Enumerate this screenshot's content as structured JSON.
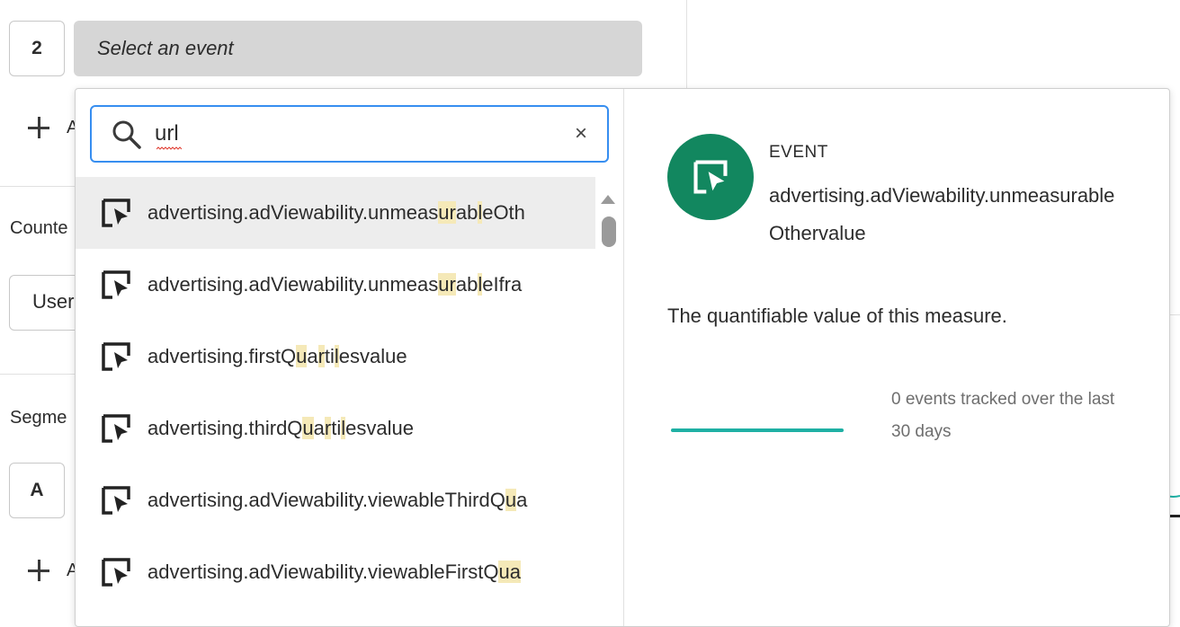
{
  "step": {
    "number": "2"
  },
  "event_select": {
    "placeholder": "Select an event"
  },
  "background": {
    "add_peek_1": "A",
    "counter_label": "Counte",
    "user_select": "User",
    "segment_label": "Segme",
    "segment_box": "A",
    "add_peek_2": "A"
  },
  "search": {
    "value": "url",
    "clear_icon": "close-icon"
  },
  "results": [
    {
      "segments": [
        [
          "advertising.adViewability.unmeas",
          false
        ],
        [
          "ur",
          true
        ],
        [
          "ab",
          false
        ],
        [
          "l",
          true
        ],
        [
          "eOth",
          false
        ]
      ],
      "selected": true
    },
    {
      "segments": [
        [
          "advertising.adViewability.unmeas",
          false
        ],
        [
          "ur",
          true
        ],
        [
          "ab",
          false
        ],
        [
          "l",
          true
        ],
        [
          "eIfra",
          false
        ]
      ],
      "selected": false
    },
    {
      "segments": [
        [
          "advertising.firstQ",
          false
        ],
        [
          "u",
          true
        ],
        [
          "a",
          false
        ],
        [
          "r",
          true
        ],
        [
          "ti",
          false
        ],
        [
          "l",
          true
        ],
        [
          "esvalue",
          false
        ]
      ],
      "selected": false
    },
    {
      "segments": [
        [
          "advertising.thirdQ",
          false
        ],
        [
          "u",
          true
        ],
        [
          "a",
          false
        ],
        [
          "r",
          true
        ],
        [
          "ti",
          false
        ],
        [
          "l",
          true
        ],
        [
          "esvalue",
          false
        ]
      ],
      "selected": false
    },
    {
      "segments": [
        [
          "advertising.adViewability.viewableThirdQ",
          false
        ],
        [
          "u",
          true
        ],
        [
          "a",
          false
        ]
      ],
      "selected": false
    },
    {
      "segments": [
        [
          "advertising.adViewability.viewableFirstQ",
          false
        ],
        [
          "ua",
          true
        ],
        [
          "",
          false
        ]
      ],
      "selected": false
    }
  ],
  "detail": {
    "type": "EVENT",
    "name": "advertising.adViewability.unmeasurableOthervalue",
    "description": "The quantifiable value of this measure.",
    "tracked": "0 events tracked over the last 30 days"
  },
  "colors": {
    "accent": "#378ef0",
    "event_green": "#12875f",
    "spark": "#1fb0a4",
    "highlight": "#f5e9b8"
  },
  "icons": {
    "event": "event-cursor-icon",
    "search": "search-icon",
    "add": "plus-icon"
  }
}
